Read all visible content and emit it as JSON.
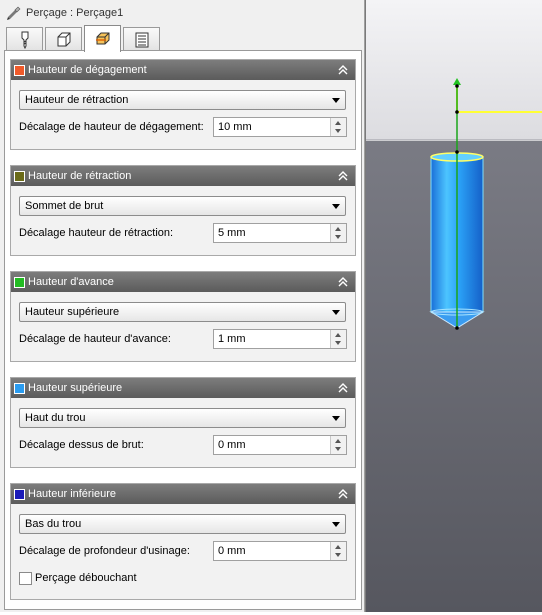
{
  "window": {
    "title": "Perçage : Perçage1",
    "title_icon": "drill-icon"
  },
  "tabs": [
    {
      "icon": "tool-icon",
      "active": false
    },
    {
      "icon": "geometry-icon",
      "active": false
    },
    {
      "icon": "heights-icon",
      "active": true
    },
    {
      "icon": "passes-icon",
      "active": false
    }
  ],
  "groups": [
    {
      "title": "Hauteur de dégagement",
      "color": "#ef5a2a",
      "select": "Hauteur de rétraction",
      "field_label": "Décalage de hauteur de dégagement:",
      "value": "10 mm"
    },
    {
      "title": "Hauteur de rétraction",
      "color": "#6b6b18",
      "select": "Sommet de brut",
      "field_label": "Décalage hauteur de rétraction:",
      "value": "5 mm"
    },
    {
      "title": "Hauteur d'avance",
      "color": "#22bb22",
      "select": "Hauteur supérieure",
      "field_label": "Décalage de hauteur d'avance:",
      "value": "1 mm"
    },
    {
      "title": "Hauteur supérieure",
      "color": "#2a9cf0",
      "select": "Haut du trou",
      "field_label": "Décalage dessus de brut:",
      "value": "0 mm"
    },
    {
      "title": "Hauteur inférieure",
      "color": "#1a1ab8",
      "select": "Bas du trou",
      "field_label": "Décalage de profondeur d'usinage:",
      "value": "0 mm",
      "checkbox_label": "Perçage débouchant",
      "checkbox_checked": false
    }
  ]
}
